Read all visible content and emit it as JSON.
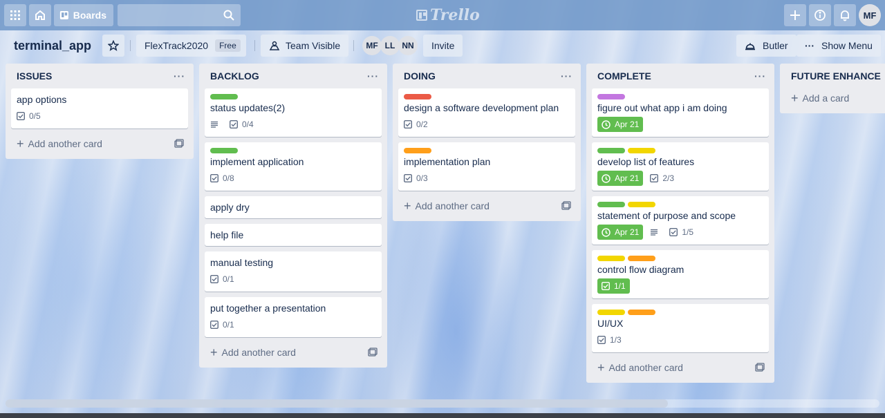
{
  "topbar": {
    "boards_label": "Boards",
    "logo_text": "Trello",
    "avatar_initials": "MF"
  },
  "board": {
    "title": "terminal_app",
    "team_name": "FlexTrack2020",
    "team_plan": "Free",
    "visibility": "Team Visible",
    "members": [
      "MF",
      "LL",
      "NN"
    ],
    "invite_label": "Invite",
    "butler_label": "Butler",
    "menu_label": "Show Menu"
  },
  "colors": {
    "green": "#61bd4f",
    "red": "#eb5a46",
    "orange": "#ff9f1a",
    "yellow": "#f2d600",
    "purple": "#c377e0"
  },
  "lists": [
    {
      "title": "ISSUES",
      "cards": [
        {
          "title": "app options",
          "labels": [],
          "checklist": "0/5"
        }
      ],
      "add_label": "Add another card"
    },
    {
      "title": "BACKLOG",
      "cards": [
        {
          "title": "status updates(2)",
          "labels": [
            "green"
          ],
          "description": true,
          "checklist": "0/4"
        },
        {
          "title": "implement application",
          "labels": [
            "green"
          ],
          "checklist": "0/8"
        },
        {
          "title": "apply dry",
          "labels": []
        },
        {
          "title": "help file",
          "labels": []
        },
        {
          "title": "manual testing",
          "labels": [],
          "checklist": "0/1"
        },
        {
          "title": "put together a presentation",
          "labels": [],
          "checklist": "0/1"
        }
      ],
      "add_label": "Add another card"
    },
    {
      "title": "DOING",
      "cards": [
        {
          "title": "design a software development plan",
          "labels": [
            "red"
          ],
          "checklist": "0/2"
        },
        {
          "title": "implementation plan",
          "labels": [
            "orange"
          ],
          "checklist": "0/3"
        }
      ],
      "add_label": "Add another card"
    },
    {
      "title": "COMPLETE",
      "cards": [
        {
          "title": "figure out what app i am doing",
          "labels": [
            "purple"
          ],
          "due": "Apr 21"
        },
        {
          "title": "develop list of features",
          "labels": [
            "green",
            "yellow"
          ],
          "due": "Apr 21",
          "checklist": "2/3"
        },
        {
          "title": "statement of purpose and scope",
          "labels": [
            "green",
            "yellow"
          ],
          "due": "Apr 21",
          "description": true,
          "checklist": "1/5"
        },
        {
          "title": "control flow diagram",
          "labels": [
            "yellow",
            "orange"
          ],
          "checklist_done": "1/1"
        },
        {
          "title": "UI/UX",
          "labels": [
            "yellow",
            "orange"
          ],
          "checklist": "1/3"
        }
      ],
      "add_label": "Add another card"
    },
    {
      "title": "FUTURE ENHANCE",
      "cards": [],
      "add_label": "Add a card"
    }
  ]
}
